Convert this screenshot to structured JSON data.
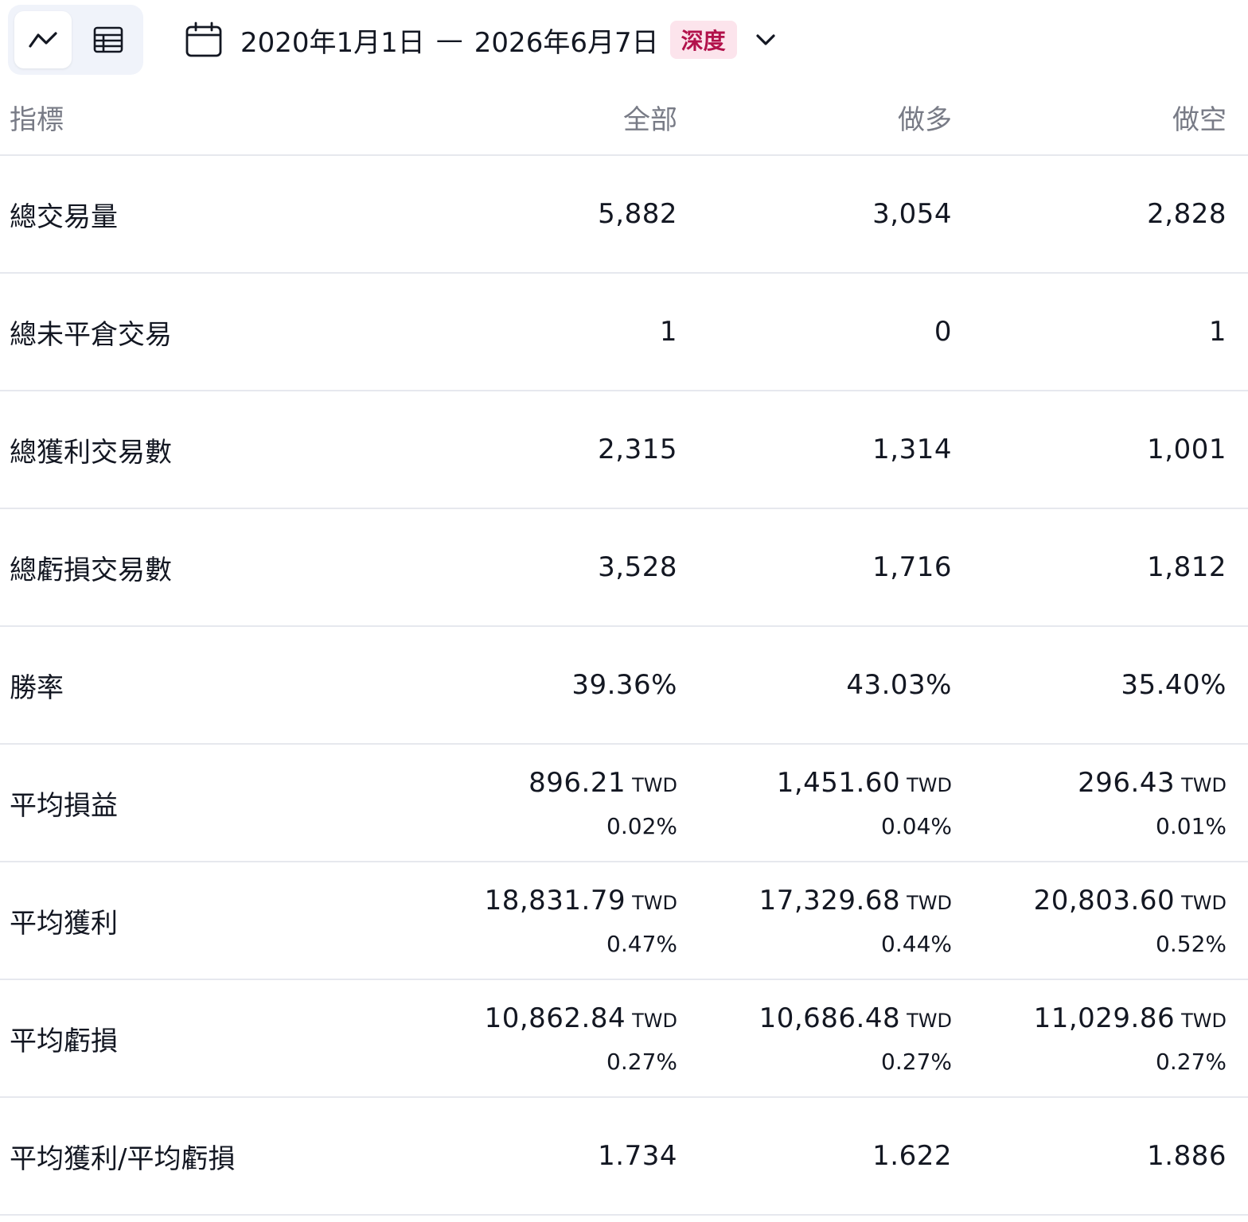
{
  "toolbar": {
    "view_chart_icon": "line-chart-icon",
    "view_table_icon": "table-icon",
    "calendar_icon": "calendar-icon",
    "date_start": "2020年1月1日",
    "date_separator": "—",
    "date_end": "2026年6月7日",
    "badge": "深度",
    "badge_color": "#b2124b",
    "dropdown_icon": "chevron-down-icon"
  },
  "table": {
    "headers": {
      "metric": "指標",
      "all": "全部",
      "long": "做多",
      "short": "做空"
    },
    "currency": "TWD",
    "rows": [
      {
        "label": "總交易量",
        "all": {
          "value": "5,882"
        },
        "long": {
          "value": "3,054"
        },
        "short": {
          "value": "2,828"
        }
      },
      {
        "label": "總未平倉交易",
        "all": {
          "value": "1"
        },
        "long": {
          "value": "0"
        },
        "short": {
          "value": "1"
        }
      },
      {
        "label": "總獲利交易數",
        "all": {
          "value": "2,315"
        },
        "long": {
          "value": "1,314"
        },
        "short": {
          "value": "1,001"
        }
      },
      {
        "label": "總虧損交易數",
        "all": {
          "value": "3,528"
        },
        "long": {
          "value": "1,716"
        },
        "short": {
          "value": "1,812"
        }
      },
      {
        "label": "勝率",
        "all": {
          "value": "39.36%"
        },
        "long": {
          "value": "43.03%"
        },
        "short": {
          "value": "35.40%"
        }
      },
      {
        "label": "平均損益",
        "all": {
          "value": "896.21",
          "unit": "TWD",
          "pct": "0.02%"
        },
        "long": {
          "value": "1,451.60",
          "unit": "TWD",
          "pct": "0.04%"
        },
        "short": {
          "value": "296.43",
          "unit": "TWD",
          "pct": "0.01%"
        }
      },
      {
        "label": "平均獲利",
        "all": {
          "value": "18,831.79",
          "unit": "TWD",
          "pct": "0.47%"
        },
        "long": {
          "value": "17,329.68",
          "unit": "TWD",
          "pct": "0.44%"
        },
        "short": {
          "value": "20,803.60",
          "unit": "TWD",
          "pct": "0.52%"
        }
      },
      {
        "label": "平均虧損",
        "all": {
          "value": "10,862.84",
          "unit": "TWD",
          "pct": "0.27%"
        },
        "long": {
          "value": "10,686.48",
          "unit": "TWD",
          "pct": "0.27%"
        },
        "short": {
          "value": "11,029.86",
          "unit": "TWD",
          "pct": "0.27%"
        }
      },
      {
        "label": "平均獲利/平均虧損",
        "all": {
          "value": "1.734"
        },
        "long": {
          "value": "1.622"
        },
        "short": {
          "value": "1.886"
        }
      }
    ]
  }
}
